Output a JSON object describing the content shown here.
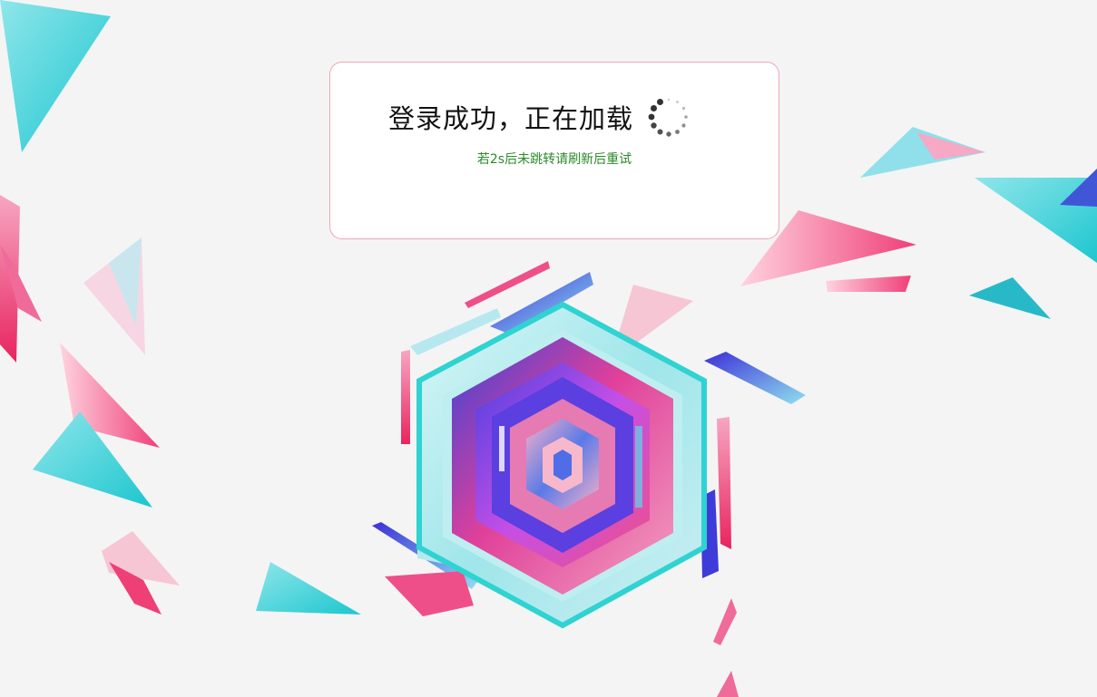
{
  "dialog": {
    "title": "登录成功，正在加载",
    "subtitle": "若2s后未跳转请刷新后重试"
  },
  "icons": {
    "spinner": "loading-spinner-icon"
  },
  "colors": {
    "background": "#f4f4f5",
    "dialog_border": "#f2a6b3",
    "subtitle_text": "#2a8a2a",
    "accent_cyan": "#2fd3d1",
    "accent_pink": "#f0407a",
    "accent_blue": "#3b3fd6",
    "accent_magenta": "#d64be0"
  }
}
